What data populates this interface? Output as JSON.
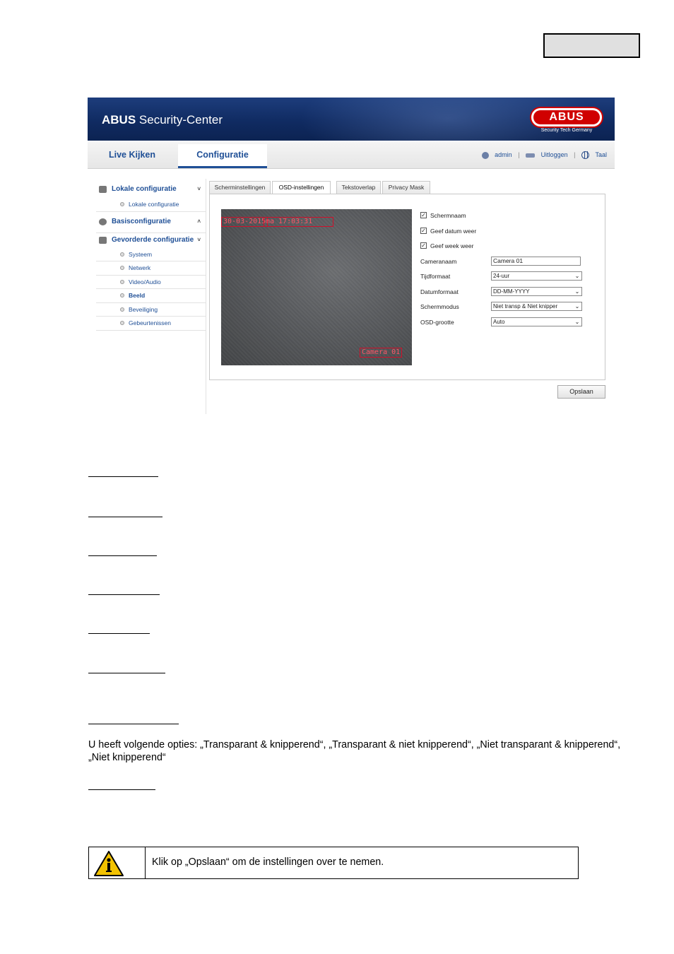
{
  "app": {
    "brand_bold": "ABUS",
    "brand_rest": "Security-Center",
    "logo_text": "ABUS",
    "logo_sub": "Security Tech Germany",
    "nav": {
      "live": "Live Kijken",
      "config": "Configuratie",
      "user": "admin",
      "logout": "Uitloggen",
      "language": "Taal",
      "separator": "|"
    },
    "sidebar": {
      "local": {
        "label": "Lokale configuratie",
        "chevron": "˅",
        "items": [
          "Lokale configuratie"
        ]
      },
      "basic": {
        "label": "Basisconfiguratie",
        "chevron": "˄"
      },
      "advanced": {
        "label": "Gevorderde configuratie",
        "chevron": "˅",
        "items": [
          "Systeem",
          "Netwerk",
          "Video/Audio",
          "Beeld",
          "Beveiliging",
          "Gebeurtenissen"
        ]
      }
    },
    "tabs": [
      "Scherminstellingen",
      "OSD-instellingen",
      "Tekstoverlap",
      "Privacy Mask"
    ],
    "active_tab": "OSD-instellingen",
    "preview": {
      "osd_date": "30-03-2015",
      "osd_time": "ma 17:03:31",
      "osd_name": "Camera 01"
    },
    "form": {
      "checkbox_mark": "✓",
      "show_name": "Schermnaam",
      "show_date": "Geef datum weer",
      "show_week": "Geef week weer",
      "camera_name_label": "Cameranaam",
      "camera_name_value": "Camera 01",
      "time_format_label": "Tijdformaat",
      "time_format_value": "24-uur",
      "date_format_label": "Datumformaat",
      "date_format_value": "DD-MM-YYYY",
      "display_mode_label": "Schermmodus",
      "display_mode_value": "Niet transp & Niet knipper",
      "osd_size_label": "OSD-grootte",
      "osd_size_value": "Auto",
      "select_arrow": "⌄"
    },
    "save_button": "Opslaan"
  },
  "document": {
    "options_paragraph": "U heeft volgende opties: „Transparant & knipperend“, „Transparant & niet knipperend“, „Niet transparant & knipperend“, „Niet                              knipperend“",
    "note_text": "Klik op „Opslaan“ om de instellingen over te nemen."
  },
  "colors": {
    "banner": "#102b62",
    "accent": "#1f4f96",
    "osd_red": "#d0102a",
    "warning_yellow": "#f2c200"
  }
}
